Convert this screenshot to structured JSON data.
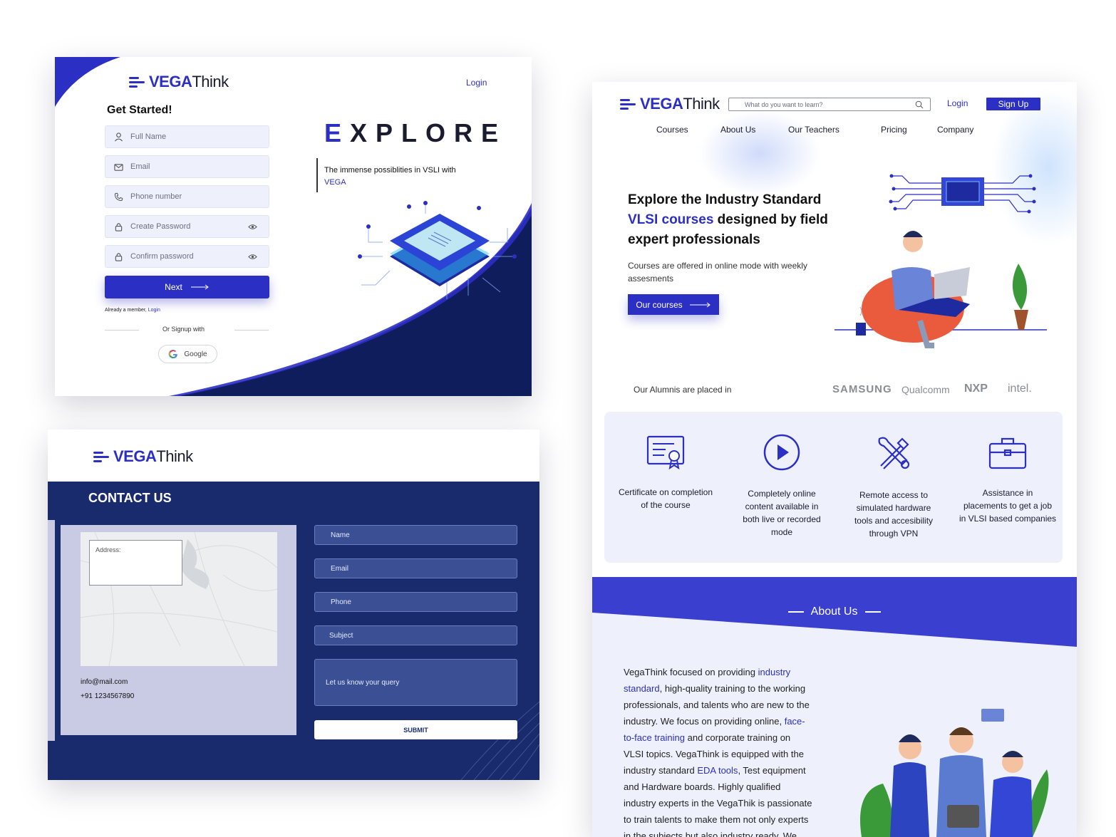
{
  "brand": {
    "part1": "VEGA",
    "part2": "Think"
  },
  "signup": {
    "login_link": "Login",
    "heading": "Get Started!",
    "fields": {
      "full_name": "Full Name",
      "email": "Email",
      "phone": "Phone number",
      "create_password": "Create Password",
      "confirm_password": "Confirm password"
    },
    "next_label": "Next",
    "already_member": "Already a member,",
    "already_login": "Login",
    "or_signup": "Or Signup with",
    "google_label": "Google",
    "explore_title": "EXPLORE",
    "explore_sub1": "The immense possiblities in VSLI with",
    "explore_sub2": "VEGA"
  },
  "contact": {
    "title": "CONTACT US",
    "address_label": "Address:",
    "email": "info@mail.com",
    "phone": "+91 1234567890",
    "fields": {
      "name": "Name",
      "email": "Email",
      "phone": "Phone",
      "subject": "Subject",
      "query": "Let us know your query"
    },
    "submit_label": "SUBMIT"
  },
  "landing": {
    "search_placeholder": "What do you want to learn?",
    "login": "Login",
    "signup": "Sign Up",
    "nav": [
      "Courses",
      "About Us",
      "Our Teachers",
      "Pricing",
      "Company"
    ],
    "hero_line1": "Explore the Industry Standard",
    "hero_line2_blue": "VLSI courses",
    "hero_line2_rest": "designed by field",
    "hero_line3": "expert professionals",
    "hero_sub1": "Courses are offered in online mode with weekly",
    "hero_sub2": "assesments",
    "courses_btn": "Our courses",
    "alumni_label": "Our Alumnis are placed in",
    "companies": [
      "SAMSUNG",
      "Qualcomm",
      "NXP",
      "intel."
    ],
    "features": [
      {
        "l1": "Certificate on completion",
        "l2": "of the course",
        "l3": "",
        "l4": "",
        "icon": "certificate-icon"
      },
      {
        "l1": "Completely online",
        "l2": "content available in",
        "l3": "both live or recorded",
        "l4": "mode",
        "icon": "play-icon"
      },
      {
        "l1": "Remote access to",
        "l2": "simulated hardware",
        "l3": "tools and accesibility",
        "l4": "through VPN",
        "icon": "tools-icon"
      },
      {
        "l1": "Assistance in",
        "l2": "placements to get a job",
        "l3": "in VLSI based companies",
        "l4": "",
        "icon": "briefcase-icon"
      }
    ],
    "about_title": "About Us",
    "about_text": [
      {
        "a": "VegaThink focused on providing ",
        "b": "industry",
        "c": ""
      },
      {
        "a": "",
        "b": "standard",
        "c": ", high-quality training to the working"
      },
      {
        "a": "professionals, and talents who are new to the",
        "b": "",
        "c": ""
      },
      {
        "a": "industry. We focus on providing online, ",
        "b": "face-",
        "c": ""
      },
      {
        "a": "",
        "b": "to-face training",
        "c": " and corporate training on"
      },
      {
        "a": "VLSI topics. VegaThink is equipped with the",
        "b": "",
        "c": ""
      },
      {
        "a": "industry standard ",
        "b": "EDA tools",
        "c": ", Test equipment"
      },
      {
        "a": "and Hardware boards. Highly qualified",
        "b": "",
        "c": ""
      },
      {
        "a": "industry experts in the VegaThik is passionate",
        "b": "",
        "c": ""
      },
      {
        "a": "to train talents to make them not only experts",
        "b": "",
        "c": ""
      },
      {
        "a": "in the subjects but also industry ready. We",
        "b": "",
        "c": ""
      }
    ]
  }
}
